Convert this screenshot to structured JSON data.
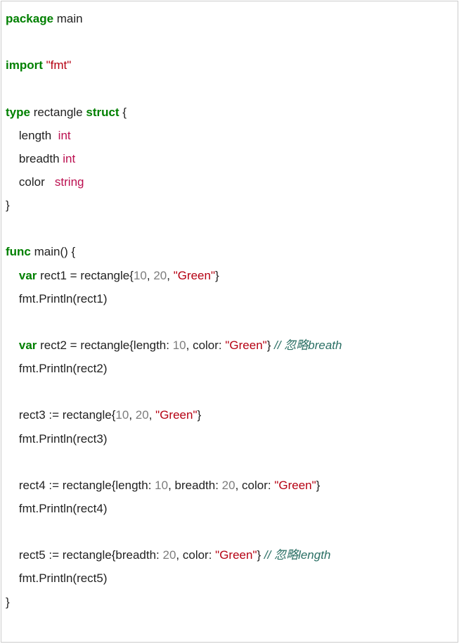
{
  "code": {
    "l1_kw_package": "package",
    "l1_pkg": " main",
    "l3_kw_import": "import",
    "l3_str": " \"fmt\"",
    "l5_kw_type": "type",
    "l5_name": " rectangle ",
    "l5_kw_struct": "struct",
    "l5_brace": " {",
    "l6_field": "    length  ",
    "l6_type": "int",
    "l7_field": "    breadth ",
    "l7_type": "int",
    "l8_field": "    color   ",
    "l8_type": "string",
    "l9_close": "}",
    "l11_kw_func": "func",
    "l11_rest": " main() {",
    "l12_kw_var": "    var",
    "l12_a": " rect1 = rectangle{",
    "l12_n1": "10",
    "l12_c1": ", ",
    "l12_n2": "20",
    "l12_c2": ", ",
    "l12_s": "\"Green\"",
    "l12_end": "}",
    "l13": "    fmt.Println(rect1)",
    "l15_kw_var": "    var",
    "l15_a": " rect2 = rectangle{length: ",
    "l15_n1": "10",
    "l15_b": ", color: ",
    "l15_s": "\"Green\"",
    "l15_end": "} ",
    "l15_cmt": "// 忽略breath",
    "l16": "    fmt.Println(rect2)",
    "l18_a": "    rect3 := rectangle{",
    "l18_n1": "10",
    "l18_c1": ", ",
    "l18_n2": "20",
    "l18_c2": ", ",
    "l18_s": "\"Green\"",
    "l18_end": "}",
    "l19": "    fmt.Println(rect3)",
    "l21_a": "    rect4 := rectangle{length: ",
    "l21_n1": "10",
    "l21_b": ", breadth: ",
    "l21_n2": "20",
    "l21_c": ", color: ",
    "l21_s": "\"Green\"",
    "l21_end": "}",
    "l22": "    fmt.Println(rect4)",
    "l24_a": "    rect5 := rectangle{breadth: ",
    "l24_n1": "20",
    "l24_b": ", color: ",
    "l24_s": "\"Green\"",
    "l24_end": "} ",
    "l24_cmt": "// 忽略length",
    "l25": "    fmt.Println(rect5)",
    "l26": "}"
  }
}
